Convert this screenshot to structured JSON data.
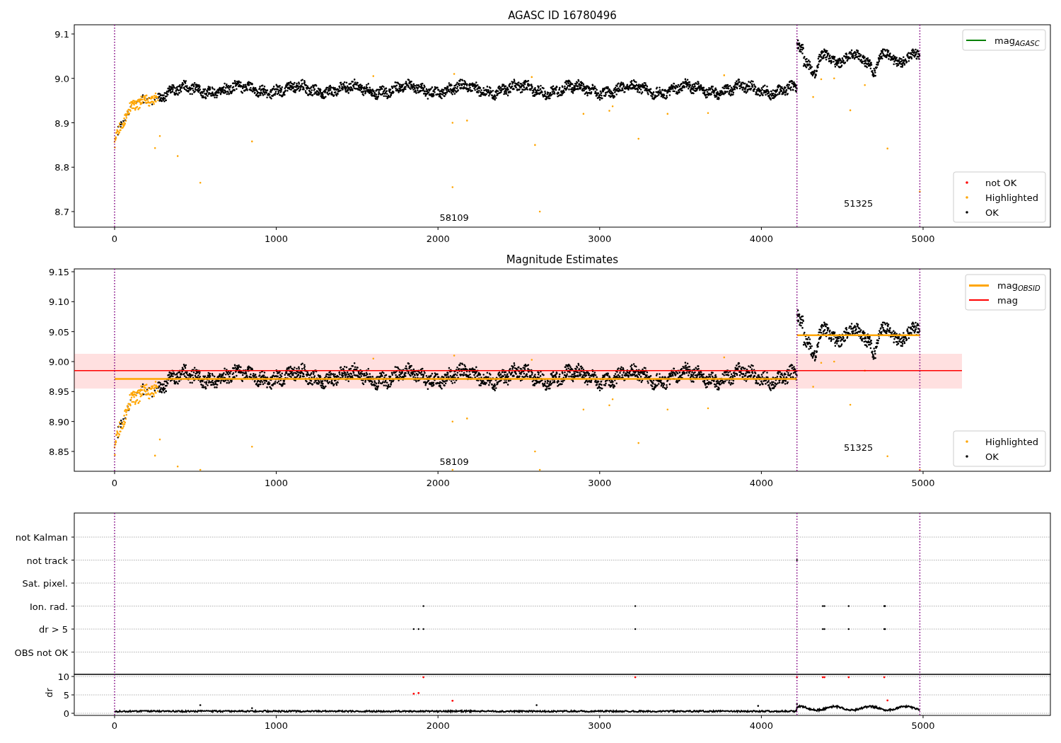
{
  "panels": [
    {
      "kind": "magnitude",
      "title": "AGASC ID 16780496",
      "yticks": [
        "9.1",
        "9.0",
        "8.9",
        "8.8",
        "8.7"
      ],
      "xticks": [
        "0",
        "1000",
        "2000",
        "3000",
        "4000",
        "5000"
      ],
      "legend_upper": [
        {
          "label": "mag$_{AGASC}$",
          "kind": "line",
          "color": "#008000"
        }
      ],
      "legend_lower": [
        {
          "label": "not OK",
          "kind": "dot",
          "color": "#ff0000"
        },
        {
          "label": "Highlighted",
          "kind": "dot",
          "color": "#ffa500"
        },
        {
          "label": "OK",
          "kind": "dot",
          "color": "#000000"
        }
      ],
      "annotations": [
        "58109",
        "51325"
      ]
    },
    {
      "kind": "estimates",
      "title": "Magnitude Estimates",
      "yticks": [
        "9.15",
        "9.10",
        "9.05",
        "9.00",
        "8.95",
        "8.90",
        "8.85"
      ],
      "xticks": [
        "0",
        "1000",
        "2000",
        "3000",
        "4000",
        "5000"
      ],
      "legend_upper": [
        {
          "label": "mag$_{OBSID}$",
          "kind": "line",
          "color": "#ffa500"
        },
        {
          "label": "mag",
          "kind": "line",
          "color": "#ff0000"
        }
      ],
      "legend_lower": [
        {
          "label": "Highlighted",
          "kind": "dot",
          "color": "#ffa500"
        },
        {
          "label": "OK",
          "kind": "dot",
          "color": "#000000"
        }
      ],
      "annotations": [
        "58109",
        "51325"
      ]
    },
    {
      "kind": "flags",
      "flags": [
        "not Kalman",
        "not track",
        "Sat. pixel.",
        "Ion. rad.",
        "dr > 5",
        "OBS not OK"
      ],
      "dr_ylabel": "dr",
      "dr_yticks": [
        "10",
        "5",
        "0"
      ],
      "xticks": [
        "0",
        "1000",
        "2000",
        "3000",
        "4000",
        "5000"
      ]
    }
  ]
}
